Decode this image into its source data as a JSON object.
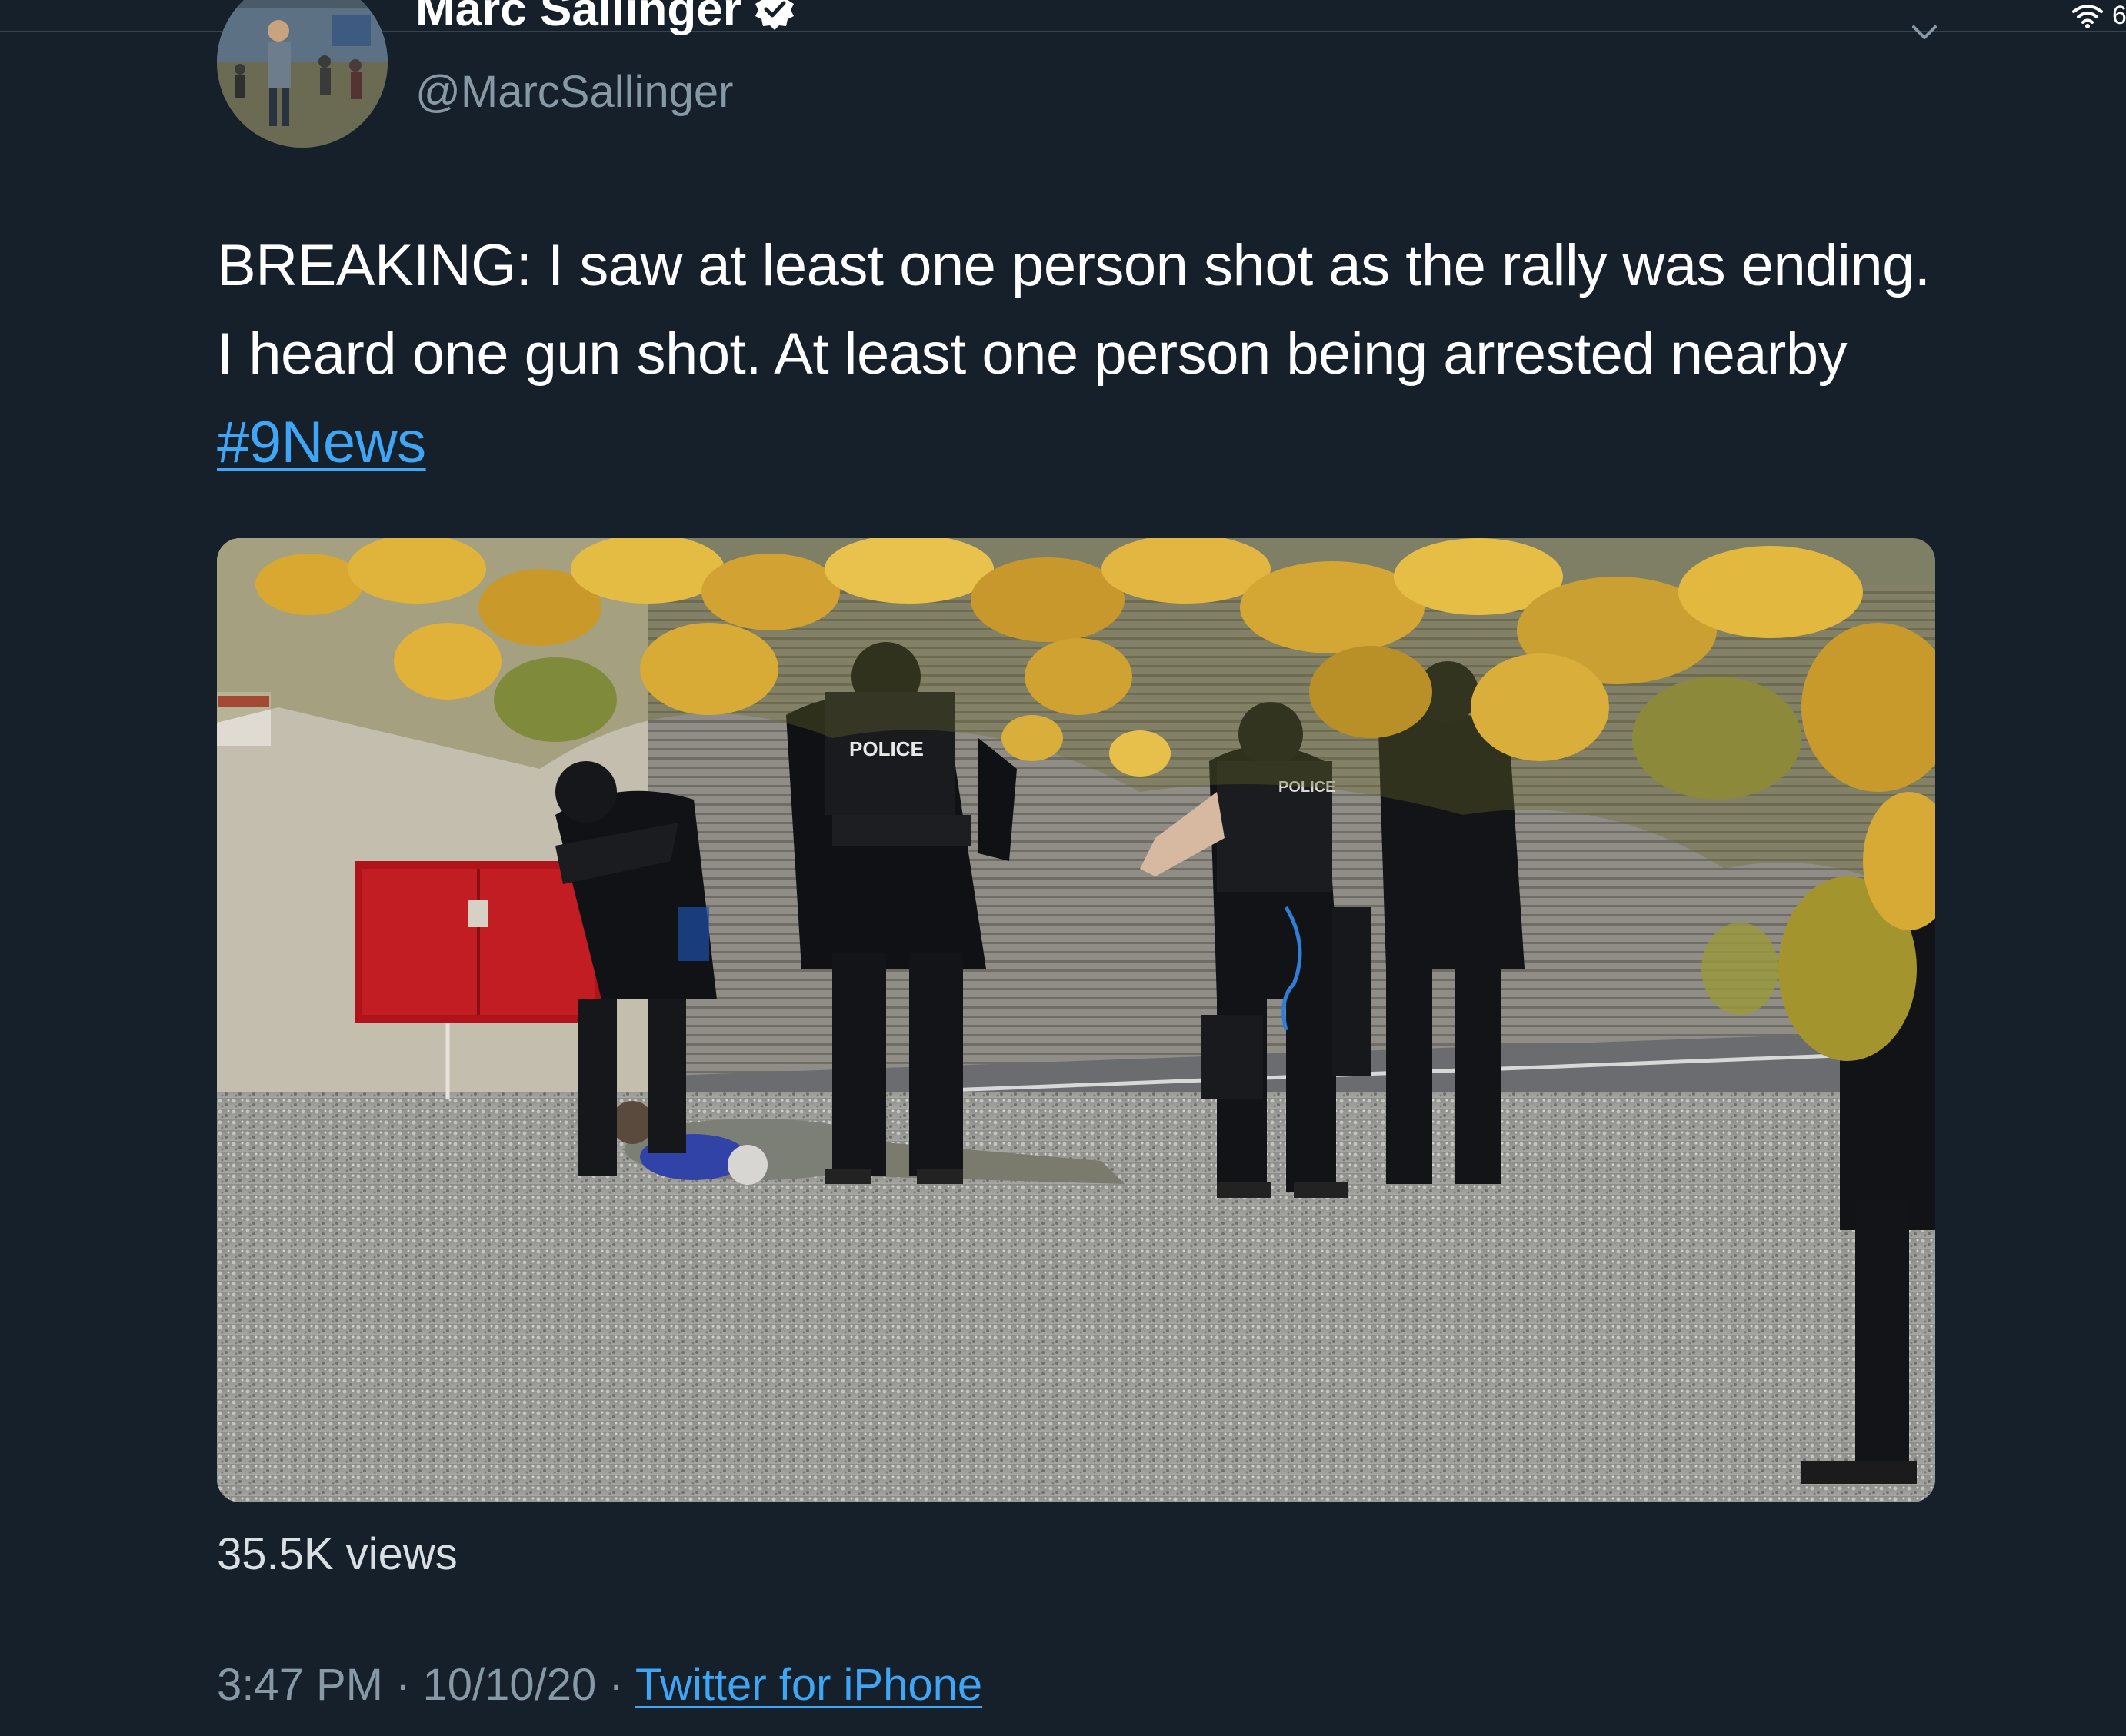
{
  "status_bar": {
    "battery_text": "6"
  },
  "tweet": {
    "author": {
      "display_name": "Marc Sallinger",
      "handle": "@MarcSallinger"
    },
    "text_main": "BREAKING: I saw at least one person shot as the rally was ending. I heard one gun shot. At least one person being arrested nearby ",
    "hashtag": "#9News",
    "media": {
      "vest_label_1": "POLICE",
      "vest_label_2": "POLICE"
    },
    "views": "35.5K views",
    "time": "3:47 PM",
    "separator_1": " · ",
    "date": "10/10/20",
    "separator_2": " · ",
    "source": "Twitter for iPhone"
  },
  "colors": {
    "background": "#15202b",
    "text_primary": "#ffffff",
    "text_secondary": "#8899a6",
    "link": "#3fa6f5"
  },
  "icons": {
    "wifi": "wifi-icon",
    "verified": "verified-badge-icon",
    "chevron": "chevron-down-icon"
  }
}
